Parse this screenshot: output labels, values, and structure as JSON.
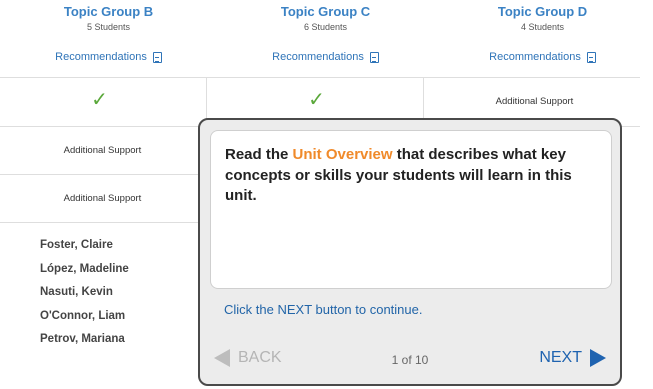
{
  "groups": [
    {
      "title": "Topic Group B",
      "count": "5 Students",
      "rec": "Recommendations"
    },
    {
      "title": "Topic Group C",
      "count": "6 Students",
      "rec": "Recommendations"
    },
    {
      "title": "Topic Group D",
      "count": "4 Students",
      "rec": "Recommendations"
    }
  ],
  "rows": {
    "row1": {
      "b": "check",
      "c": "check",
      "d": "Additional Support"
    },
    "row2": {
      "b": "Additional Support"
    },
    "row3": {
      "b": "Additional Support"
    }
  },
  "students": [
    "Foster, Claire",
    "López, Madeline",
    "Nasuti, Kevin",
    "O'Connor, Liam",
    "Petrov, Mariana"
  ],
  "popover": {
    "msg_before": "Read the ",
    "msg_highlight": "Unit Overview",
    "msg_after": " that describes what key concepts or skills your students will learn in this unit.",
    "hint": "Click the NEXT button to continue.",
    "back_label": "BACK",
    "page_indicator": "1 of 10",
    "next_label": "NEXT"
  },
  "colors": {
    "accent": "#3b82c4",
    "highlight": "#f08a2a",
    "check": "#5aa83a",
    "next": "#1f63b0"
  }
}
